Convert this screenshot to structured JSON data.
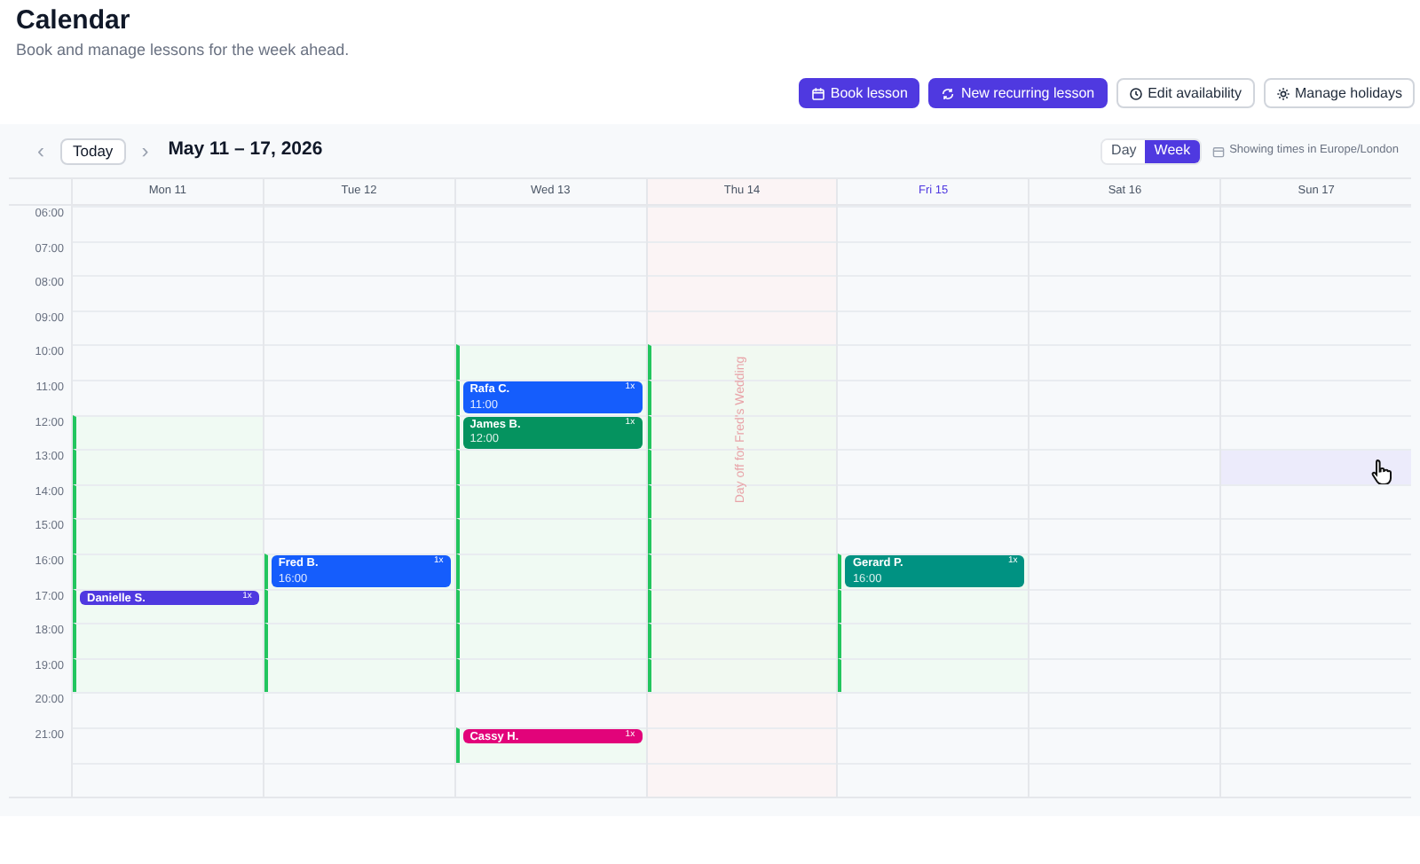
{
  "page": {
    "title": "Calendar",
    "subtitle": "Book and manage lessons for the week ahead."
  },
  "actions": [
    {
      "label": "Book lesson",
      "kind": "primary"
    },
    {
      "label": "New recurring lesson",
      "kind": "primary"
    },
    {
      "label": "Edit availability",
      "kind": "secondary"
    },
    {
      "label": "Manage holidays",
      "kind": "secondary"
    }
  ],
  "toolbar": {
    "prev": "‹",
    "today": "Today",
    "next": "›",
    "range": "May 11 – 17, 2026",
    "views": [
      {
        "label": "Day",
        "selected": false
      },
      {
        "label": "Week",
        "selected": true
      }
    ],
    "timezone": "Showing times in Europe/London"
  },
  "hours": [
    "06:00",
    "07:00",
    "08:00",
    "09:00",
    "10:00",
    "11:00",
    "12:00",
    "13:00",
    "14:00",
    "15:00",
    "16:00",
    "17:00",
    "18:00",
    "19:00",
    "20:00",
    "21:00"
  ],
  "days": [
    {
      "label": "Mon 11",
      "today": false,
      "slots": [
        {
          "available": false
        },
        {
          "available": false
        },
        {
          "available": false
        },
        {
          "available": false
        },
        {
          "available": false
        },
        {
          "available": false
        },
        {
          "available": true
        },
        {
          "available": true
        },
        {
          "available": true
        },
        {
          "available": true
        },
        {
          "available": true
        },
        {
          "available": true,
          "event": {
            "name": "Danielle S.",
            "badge": "1x",
            "kind": "short",
            "color": "#4f39e0"
          }
        },
        {
          "available": true
        },
        {
          "available": true
        },
        {
          "available": false
        },
        {
          "available": false
        },
        {
          "available": false
        }
      ]
    },
    {
      "label": "Tue 12",
      "today": false,
      "slots": [
        {
          "available": false
        },
        {
          "available": false
        },
        {
          "available": false
        },
        {
          "available": false
        },
        {
          "available": false
        },
        {
          "available": false
        },
        {
          "available": false
        },
        {
          "available": false
        },
        {
          "available": false
        },
        {
          "available": false
        },
        {
          "available": true,
          "event": {
            "name": "Fred B.",
            "time": "16:00",
            "badge": "1x",
            "kind": "long",
            "color": "#155dfc"
          }
        },
        {
          "available": true
        },
        {
          "available": true
        },
        {
          "available": true
        },
        {
          "available": false
        },
        {
          "available": false
        },
        {
          "available": false
        }
      ]
    },
    {
      "label": "Wed 13",
      "today": false,
      "slots": [
        {
          "available": false
        },
        {
          "available": false
        },
        {
          "available": false
        },
        {
          "available": false
        },
        {
          "available": true
        },
        {
          "available": true,
          "event": {
            "name": "Rafa C.",
            "time": "11:00",
            "badge": "1x",
            "kind": "long",
            "color": "#155dfc"
          }
        },
        {
          "available": true,
          "event": {
            "name": "James B.",
            "time": "12:00",
            "badge": "1x",
            "kind": "long",
            "color": "#05935f"
          }
        },
        {
          "available": true
        },
        {
          "available": true
        },
        {
          "available": true
        },
        {
          "available": true
        },
        {
          "available": true
        },
        {
          "available": true
        },
        {
          "available": true
        },
        {
          "available": false
        },
        {
          "available": true,
          "event": {
            "name": "Cassy H.",
            "badge": "1x",
            "kind": "short",
            "color": "#e2037a"
          }
        },
        {
          "available": false
        }
      ]
    },
    {
      "label": "Thu 14",
      "today": false,
      "holiday": "Day off for Fred's Wedding",
      "slots": [
        {
          "available": false
        },
        {
          "available": false
        },
        {
          "available": false
        },
        {
          "available": false
        },
        {
          "available": true
        },
        {
          "available": true
        },
        {
          "available": true
        },
        {
          "available": true
        },
        {
          "available": true
        },
        {
          "available": true
        },
        {
          "available": true
        },
        {
          "available": true
        },
        {
          "available": true
        },
        {
          "available": true
        },
        {
          "available": false
        },
        {
          "available": false
        },
        {
          "available": false
        }
      ]
    },
    {
      "label": "Fri 15",
      "today": true,
      "slots": [
        {
          "available": false
        },
        {
          "available": false
        },
        {
          "available": false
        },
        {
          "available": false
        },
        {
          "available": false
        },
        {
          "available": false
        },
        {
          "available": false
        },
        {
          "available": false
        },
        {
          "available": false
        },
        {
          "available": false
        },
        {
          "available": true,
          "event": {
            "name": "Gerard P.",
            "time": "16:00",
            "badge": "1x",
            "kind": "long",
            "color": "#009282"
          }
        },
        {
          "available": true
        },
        {
          "available": true
        },
        {
          "available": true
        },
        {
          "available": false
        },
        {
          "available": false
        },
        {
          "available": false
        }
      ]
    },
    {
      "label": "Sat 16",
      "today": false,
      "slots": [
        {
          "available": false
        },
        {
          "available": false
        },
        {
          "available": false
        },
        {
          "available": false
        },
        {
          "available": false
        },
        {
          "available": false
        },
        {
          "available": false
        },
        {
          "available": false
        },
        {
          "available": false
        },
        {
          "available": false
        },
        {
          "available": false
        },
        {
          "available": false
        },
        {
          "available": false
        },
        {
          "available": false
        },
        {
          "available": false
        },
        {
          "available": false
        },
        {
          "available": false
        }
      ]
    },
    {
      "label": "Sun 17",
      "today": false,
      "slots": [
        {
          "available": false,
          "hovered": false
        },
        {
          "available": false,
          "hovered": false
        },
        {
          "available": false,
          "hovered": false
        },
        {
          "available": false,
          "hovered": false
        },
        {
          "available": false,
          "hovered": false
        },
        {
          "available": false,
          "hovered": false
        },
        {
          "available": false,
          "hovered": false
        },
        {
          "available": false,
          "hovered": true
        },
        {
          "available": false,
          "hovered": false
        },
        {
          "available": false,
          "hovered": false
        },
        {
          "available": false,
          "hovered": false
        },
        {
          "available": false,
          "hovered": false
        },
        {
          "available": false,
          "hovered": false
        },
        {
          "available": false,
          "hovered": false
        },
        {
          "available": false,
          "hovered": false
        },
        {
          "available": false,
          "hovered": false
        },
        {
          "available": false,
          "hovered": false
        }
      ]
    }
  ]
}
